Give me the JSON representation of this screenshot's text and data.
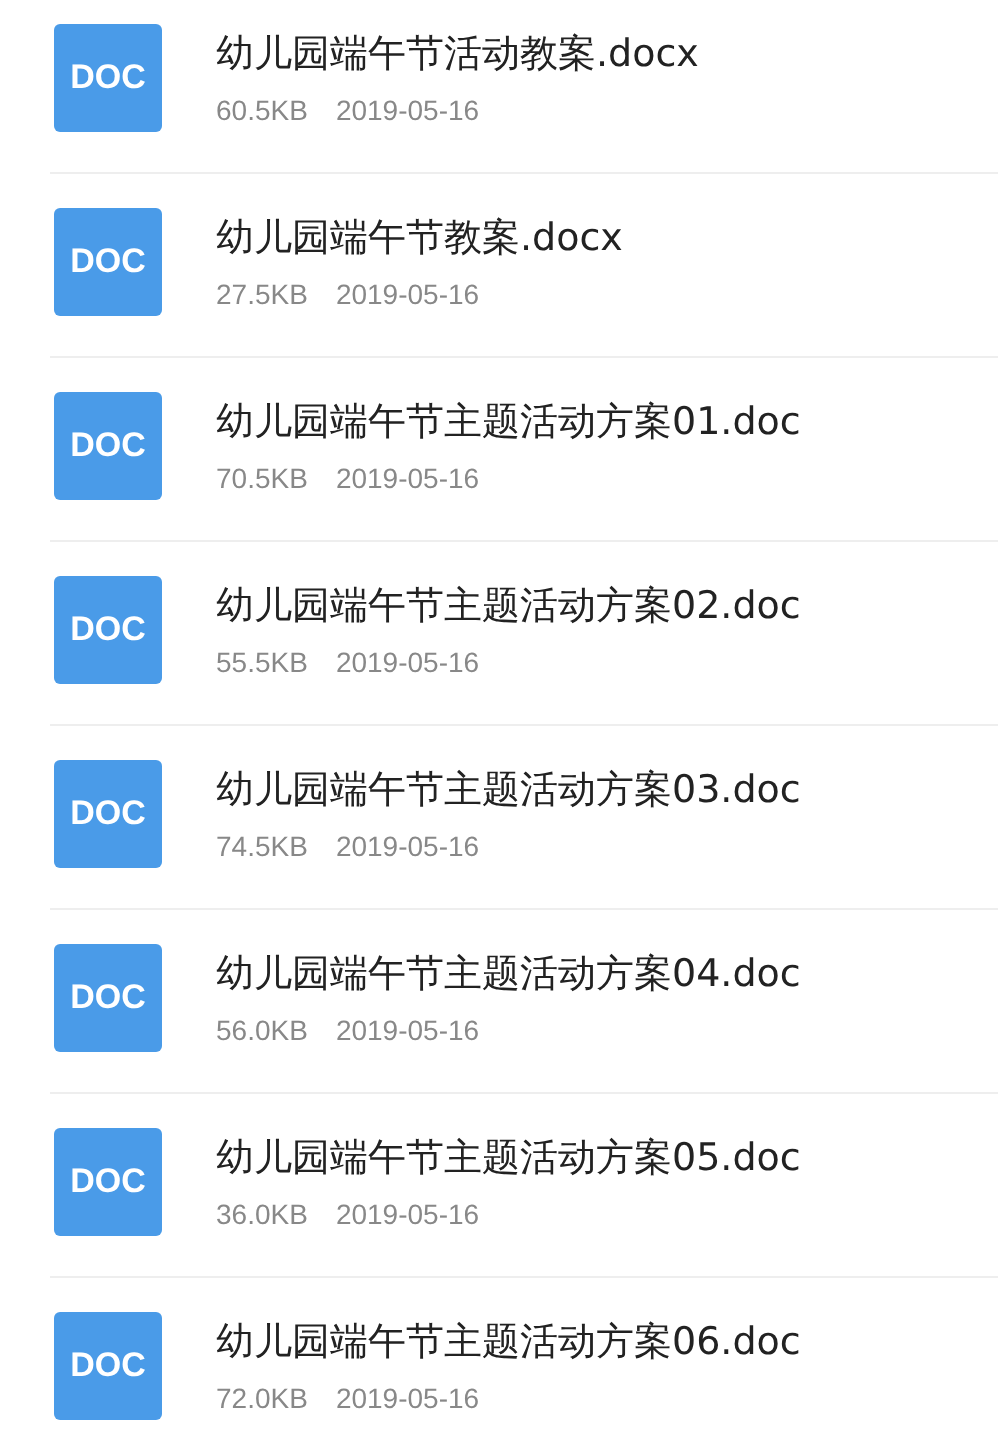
{
  "files": [
    {
      "icon": "DOC",
      "name": "幼儿园端午节活动教案.docx",
      "size": "60.5KB",
      "date": "2019-05-16"
    },
    {
      "icon": "DOC",
      "name": "幼儿园端午节教案.docx",
      "size": "27.5KB",
      "date": "2019-05-16"
    },
    {
      "icon": "DOC",
      "name": "幼儿园端午节主题活动方案01.doc",
      "size": "70.5KB",
      "date": "2019-05-16"
    },
    {
      "icon": "DOC",
      "name": "幼儿园端午节主题活动方案02.doc",
      "size": "55.5KB",
      "date": "2019-05-16"
    },
    {
      "icon": "DOC",
      "name": "幼儿园端午节主题活动方案03.doc",
      "size": "74.5KB",
      "date": "2019-05-16"
    },
    {
      "icon": "DOC",
      "name": "幼儿园端午节主题活动方案04.doc",
      "size": "56.0KB",
      "date": "2019-05-16"
    },
    {
      "icon": "DOC",
      "name": "幼儿园端午节主题活动方案05.doc",
      "size": "36.0KB",
      "date": "2019-05-16"
    },
    {
      "icon": "DOC",
      "name": "幼儿园端午节主题活动方案06.doc",
      "size": "72.0KB",
      "date": "2019-05-16"
    }
  ]
}
